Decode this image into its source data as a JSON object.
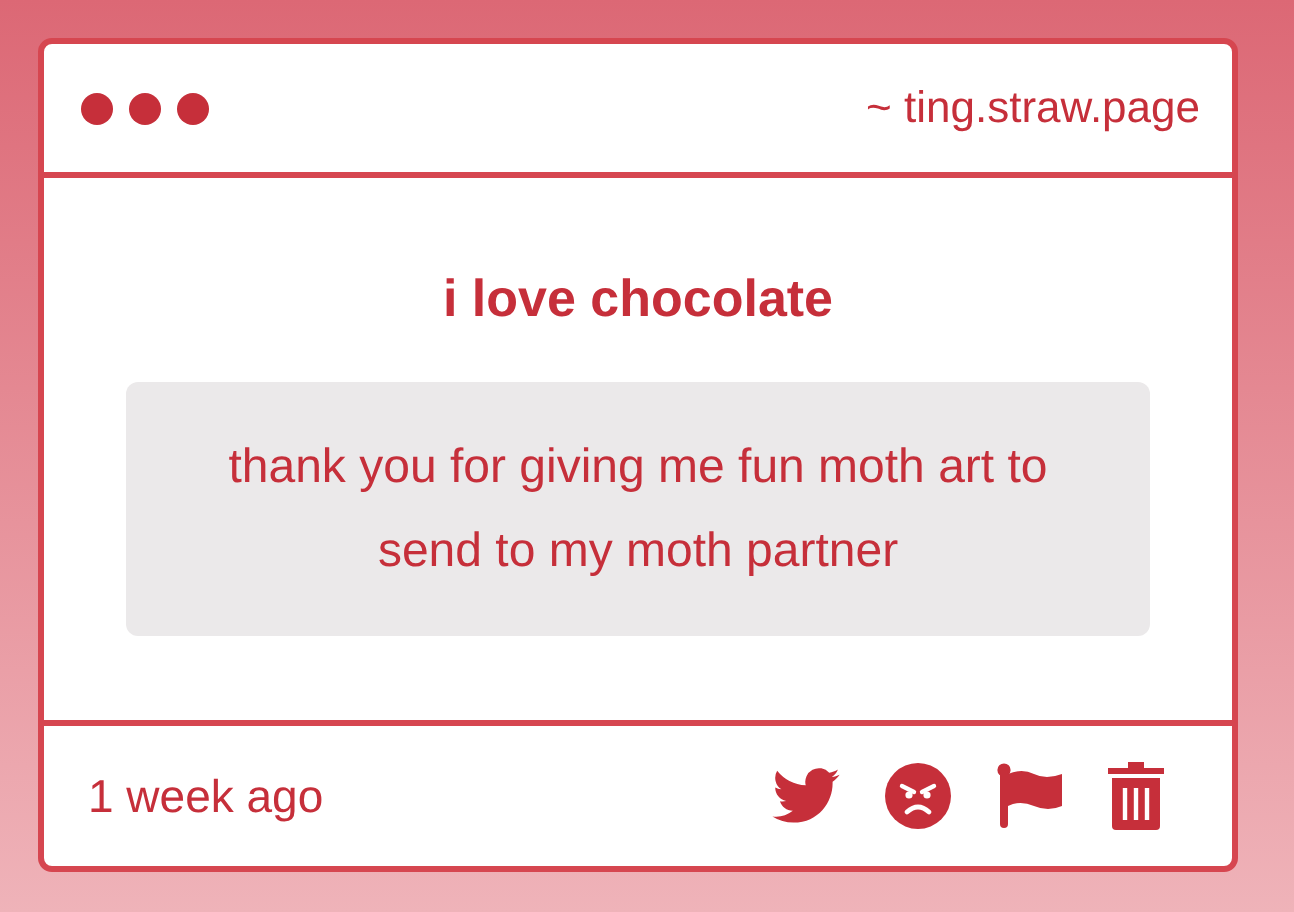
{
  "header": {
    "address": "~ ting.straw.page"
  },
  "note": {
    "title": "i love chocolate",
    "message": "thank you for giving me fun moth art to send to my moth partner"
  },
  "footer": {
    "time": "1 week ago"
  }
}
